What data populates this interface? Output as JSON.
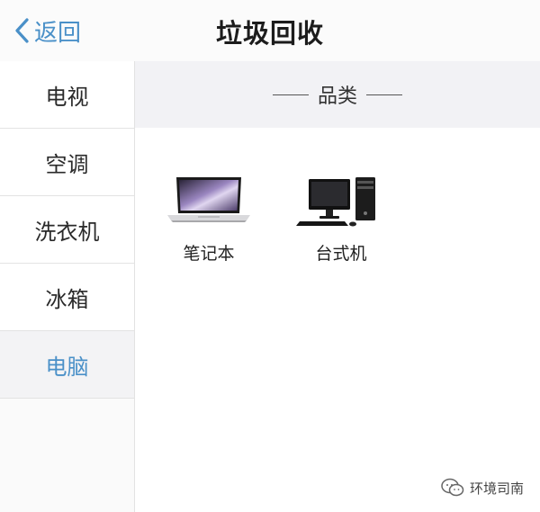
{
  "navbar": {
    "back_label": "返回",
    "title": "垃圾回收"
  },
  "sidebar": {
    "items": [
      {
        "label": "电视",
        "active": false
      },
      {
        "label": "空调",
        "active": false
      },
      {
        "label": "洗衣机",
        "active": false
      },
      {
        "label": "冰箱",
        "active": false
      },
      {
        "label": "电脑",
        "active": true
      }
    ]
  },
  "content": {
    "section_title": "品类",
    "products": [
      {
        "label": "笔记本",
        "icon": "laptop-icon"
      },
      {
        "label": "台式机",
        "icon": "desktop-computer-icon"
      }
    ]
  },
  "watermark": {
    "text": "环境司南"
  },
  "colors": {
    "accent": "#4a90c8",
    "header_bg": "#f2f2f5"
  }
}
